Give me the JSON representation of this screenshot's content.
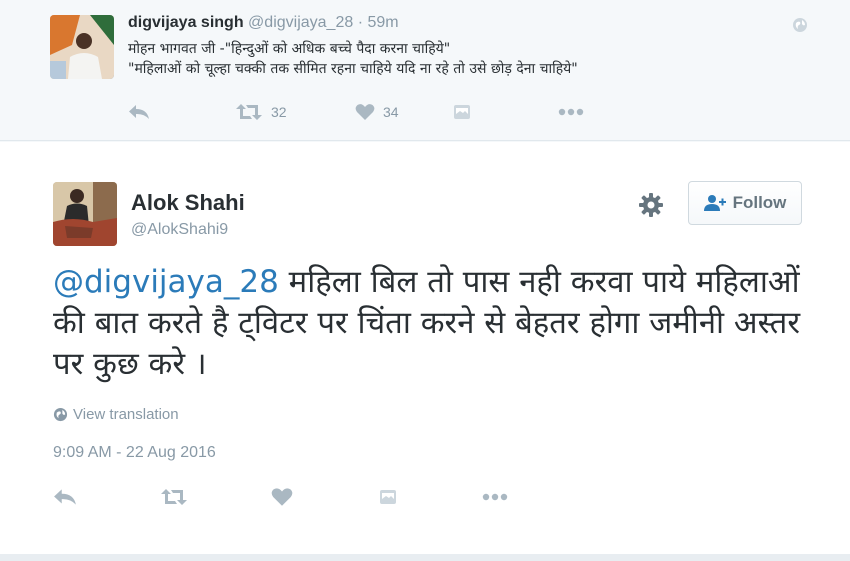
{
  "parent_tweet": {
    "fullname": "digvijaya singh",
    "handle": "@digvijaya_28",
    "separator": "·",
    "time": "59m",
    "line1": "मोहन भागवत जी -\"हिन्दुओं को अधिक बच्चे पैदा करना चाहिये\"",
    "line2": "\"महिलाओं को चूल्हा चक्की तक सीमित रहना चाहिये यदि ना रहे तो उसे छोड़ देना चाहिये\"",
    "retweet_count": "32",
    "like_count": "34"
  },
  "main_tweet": {
    "fullname": "Alok Shahi",
    "handle": "@AlokShahi9",
    "follow_label": "Follow",
    "mention": "@digvijaya_28",
    "text": " महिला बिल तो पास नही करवा पाये महिलाओं की बात करते है ट्विटर पर चिंता करने से बेहतर होगा जमीनी अस्तर पर कुछ करे ।",
    "view_translation": "View translation",
    "timestamp": "9:09 AM - 22 Aug 2016"
  },
  "colors": {
    "link_blue": "#2b7bb9",
    "muted_gray": "#8899a6",
    "icon_gray": "#aab8c2",
    "text_dark": "#292f33"
  },
  "icons": [
    "globe-icon",
    "reply-icon",
    "retweet-icon",
    "like-icon",
    "dm-icon",
    "more-icon",
    "gear-icon",
    "follow-person-icon"
  ]
}
